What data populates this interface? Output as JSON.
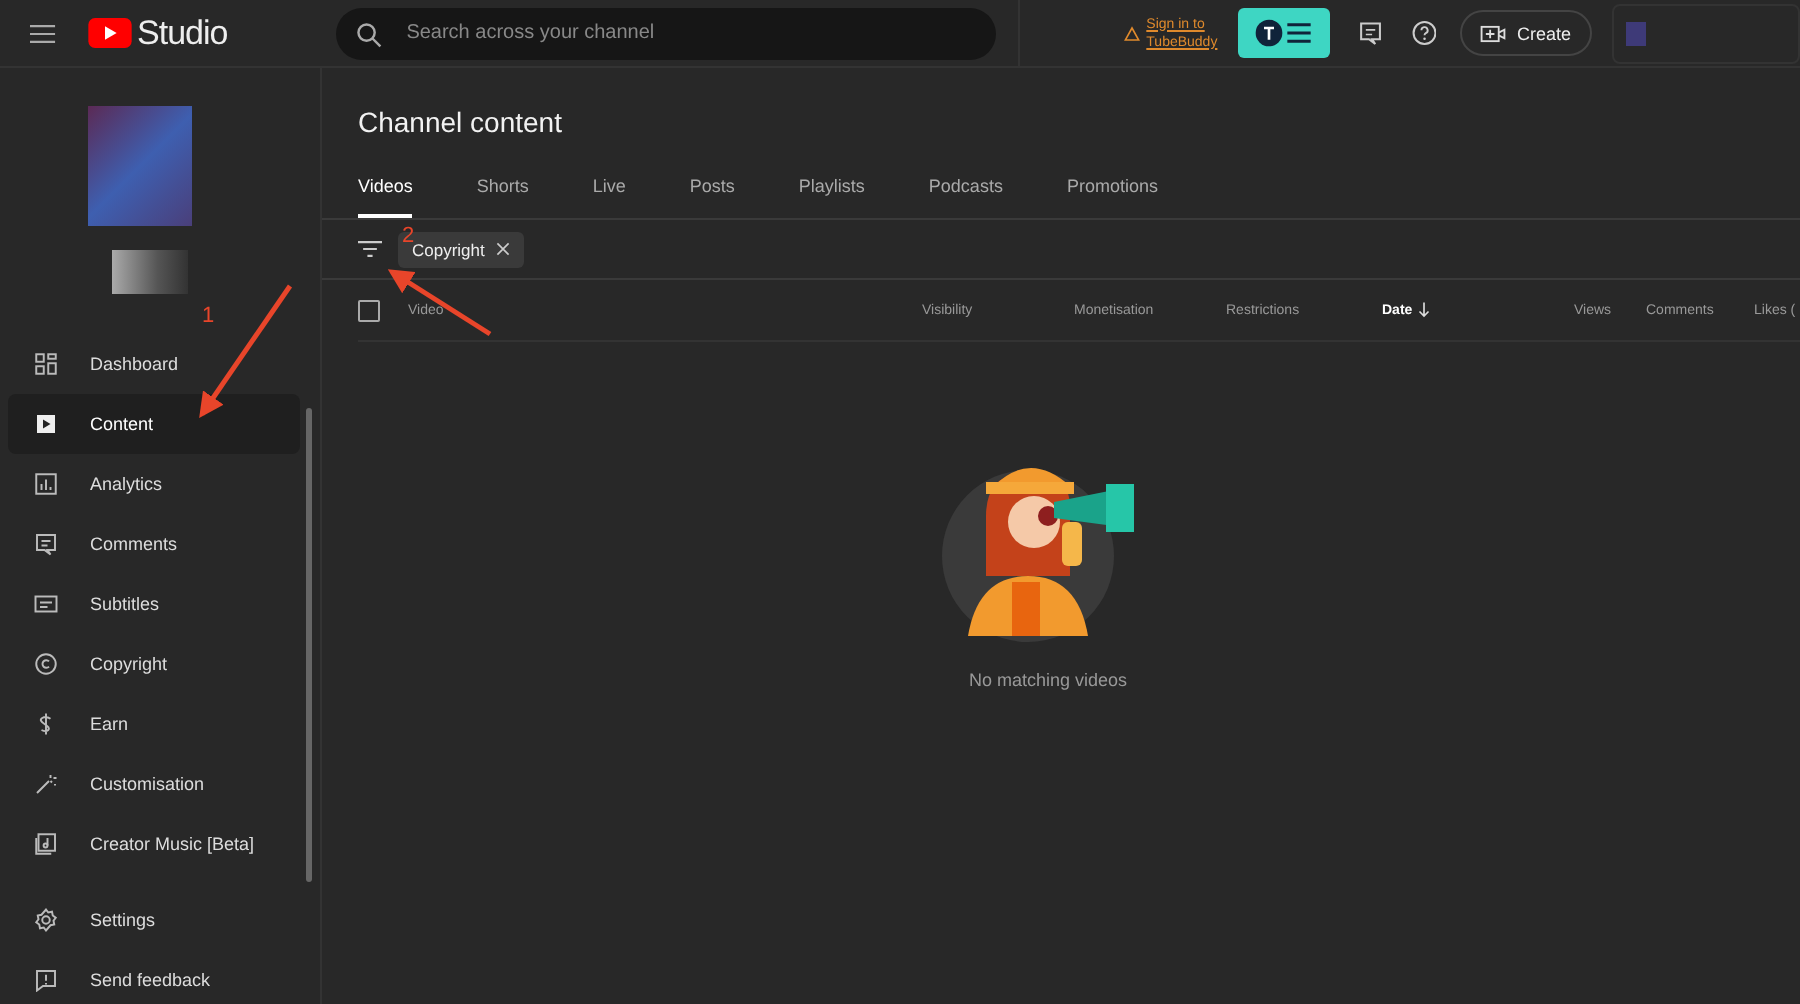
{
  "header": {
    "logo": "Studio",
    "search": {
      "placeholder": "Search across your channel"
    },
    "tubebuddy_link": "Sign in to TubeBuddy",
    "create_button": "Create"
  },
  "sidebar": {
    "items": [
      {
        "label": "Dashboard",
        "selected": false
      },
      {
        "label": "Content",
        "selected": true
      },
      {
        "label": "Analytics",
        "selected": false
      },
      {
        "label": "Comments",
        "selected": false
      },
      {
        "label": "Subtitles",
        "selected": false
      },
      {
        "label": "Copyright",
        "selected": false
      },
      {
        "label": "Earn",
        "selected": false
      },
      {
        "label": "Customisation",
        "selected": false
      },
      {
        "label": "Creator Music [Beta]",
        "selected": false
      }
    ],
    "footer_items": [
      {
        "label": "Settings"
      },
      {
        "label": "Send feedback"
      }
    ]
  },
  "page_title": "Channel content",
  "tabs": [
    {
      "label": "Videos",
      "selected": true
    },
    {
      "label": "Shorts",
      "selected": false
    },
    {
      "label": "Live",
      "selected": false
    },
    {
      "label": "Posts",
      "selected": false
    },
    {
      "label": "Playlists",
      "selected": false
    },
    {
      "label": "Podcasts",
      "selected": false
    },
    {
      "label": "Promotions",
      "selected": false
    }
  ],
  "filter_chip": "Copyright",
  "table": {
    "select_all": {
      "checked": false
    },
    "columns": [
      {
        "label": "Video",
        "sorted": false
      },
      {
        "label": "Visibility",
        "sorted": false
      },
      {
        "label": "Monetisation",
        "sorted": false
      },
      {
        "label": "Restrictions",
        "sorted": false
      },
      {
        "label": "Date",
        "sorted": true
      },
      {
        "label": "Views",
        "sorted": false
      },
      {
        "label": "Comments",
        "sorted": false
      },
      {
        "label": "Likes (",
        "sorted": false
      }
    ]
  },
  "empty_state": "No matching videos",
  "annotations": [
    {
      "label": "1"
    },
    {
      "label": "2"
    }
  ]
}
